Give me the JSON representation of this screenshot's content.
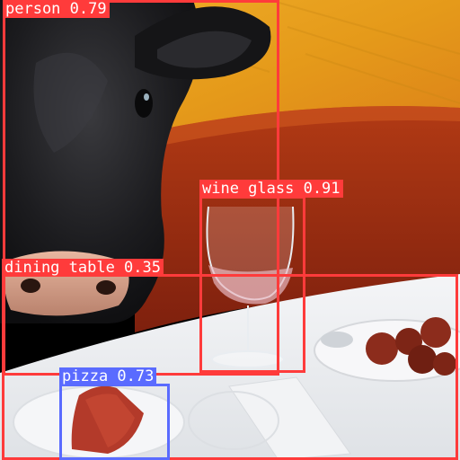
{
  "image": {
    "description_free": true
  },
  "detections": [
    {
      "label": "person 0.79",
      "color": "#ff3b3b"
    },
    {
      "label": "wine glass 0.91",
      "color": "#ff3b3b"
    },
    {
      "label": "dining table 0.35",
      "color": "#ff3b3b"
    },
    {
      "label": "pizza 0.73",
      "color": "#5a6bff"
    }
  ],
  "palette": {
    "wall_yellow": "#e9a21c",
    "wall_orange": "#c9531c",
    "booth_red": "#9b2a12",
    "tablecloth": "#eef0f2",
    "cow_black": "#1c1c1e",
    "cow_nose": "#d9a08a",
    "meat": "#8c2c1c"
  }
}
